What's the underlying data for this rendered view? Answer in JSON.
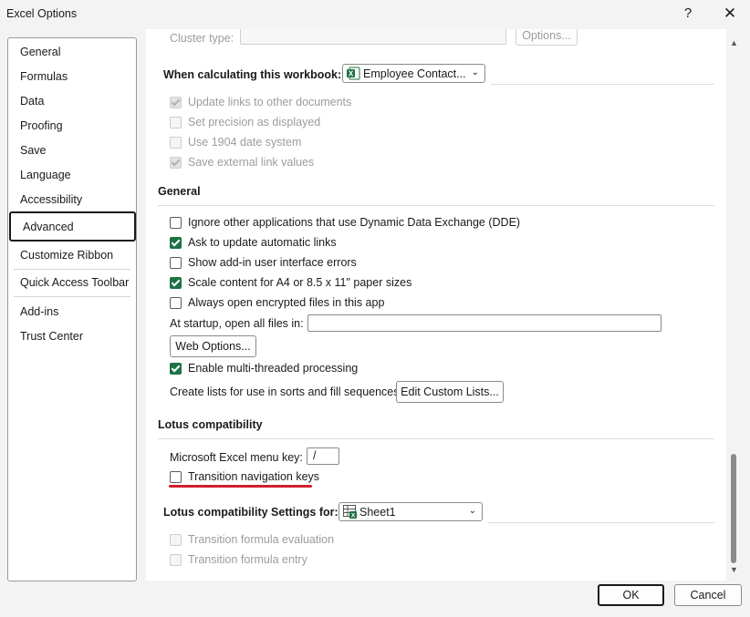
{
  "window": {
    "title": "Excel Options",
    "help_glyph": "?",
    "close_glyph": "✕"
  },
  "colors": {
    "accent": "#1e7145",
    "annotation": "#d0202c"
  },
  "nav": {
    "items": [
      {
        "label": "General"
      },
      {
        "label": "Formulas"
      },
      {
        "label": "Data"
      },
      {
        "label": "Proofing"
      },
      {
        "label": "Save"
      },
      {
        "label": "Language"
      },
      {
        "label": "Accessibility"
      },
      {
        "label": "Advanced"
      },
      {
        "label": "Customize Ribbon"
      },
      {
        "label": "Quick Access Toolbar"
      },
      {
        "label": "Add-ins"
      },
      {
        "label": "Trust Center"
      }
    ],
    "selected": "Advanced"
  },
  "content": {
    "cluster_type_label": "Cluster type:",
    "options_button": "Options...",
    "calc_workbook": {
      "label": "When calculating this workbook:",
      "selected": "Employee Contact...",
      "icon": "excel-file-icon",
      "options": [
        {
          "label": "Update links to other documents",
          "checked": true,
          "enabled": false
        },
        {
          "label": "Set precision as displayed",
          "checked": false,
          "enabled": false
        },
        {
          "label": "Use 1904 date system",
          "checked": false,
          "enabled": false
        },
        {
          "label": "Save external link values",
          "checked": true,
          "enabled": false
        }
      ]
    },
    "general": {
      "heading": "General",
      "options": [
        {
          "label": "Ignore other applications that use Dynamic Data Exchange (DDE)",
          "checked": false
        },
        {
          "label": "Ask to update automatic links",
          "checked": true
        },
        {
          "label": "Show add-in user interface errors",
          "checked": false
        },
        {
          "label": "Scale content for A4 or 8.5 x 11\" paper sizes",
          "checked": true
        },
        {
          "label": "Always open encrypted files in this app",
          "checked": false
        }
      ],
      "startup_label": "At startup, open all files in:",
      "startup_value": "",
      "web_options_button": "Web Options...",
      "multithread": {
        "label": "Enable multi-threaded processing",
        "checked": true
      },
      "custom_lists_label": "Create lists for use in sorts and fill sequences:",
      "custom_lists_button": "Edit Custom Lists..."
    },
    "lotus": {
      "heading": "Lotus compatibility",
      "menu_key_label": "Microsoft Excel menu key:",
      "menu_key_value": "/",
      "transition_nav": {
        "label": "Transition navigation keys",
        "checked": false
      }
    },
    "lotus_settings": {
      "label": "Lotus compatibility Settings for:",
      "selected": "Sheet1",
      "icon": "sheet-icon",
      "options": [
        {
          "label": "Transition formula evaluation",
          "checked": false,
          "enabled": false
        },
        {
          "label": "Transition formula entry",
          "checked": false,
          "enabled": false
        }
      ]
    }
  },
  "footer": {
    "ok": "OK",
    "cancel": "Cancel"
  }
}
